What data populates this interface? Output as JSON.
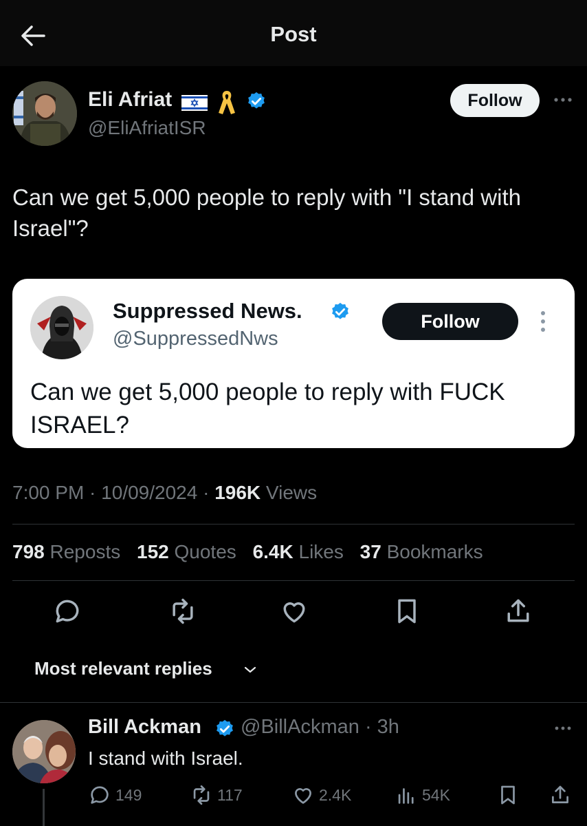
{
  "header": {
    "title": "Post"
  },
  "post": {
    "author": {
      "name": "Eli Afriat",
      "handle": "@EliAfriatISR"
    },
    "follow_label": "Follow",
    "text": "Can we get 5,000 people to reply with \"I stand with Israel\"?",
    "quote": {
      "name": "Suppressed News.",
      "handle": "@SuppressedNws",
      "follow_label": "Follow",
      "text": "Can we get 5,000 people to reply with FUCK ISRAEL?"
    },
    "time": "7:00 PM",
    "date": "10/09/2024",
    "views_count": "196K",
    "views_label": "Views",
    "stats": [
      {
        "count": "798",
        "label": "Reposts"
      },
      {
        "count": "152",
        "label": "Quotes"
      },
      {
        "count": "6.4K",
        "label": "Likes"
      },
      {
        "count": "37",
        "label": "Bookmarks"
      }
    ]
  },
  "replies": {
    "sort_label": "Most relevant replies",
    "items": [
      {
        "name": "Bill Ackman",
        "handle": "@BillAckman",
        "time": "3h",
        "text": "I stand with Israel.",
        "replies": "149",
        "reposts": "117",
        "likes": "2.4K",
        "views": "54K"
      }
    ]
  },
  "colors": {
    "background": "#000000",
    "verified": "#1d9bf0",
    "muted": "#71767b",
    "text": "#e7e9ea"
  },
  "icons": [
    "back-arrow-icon",
    "israel-flag-icon",
    "yellow-ribbon-icon",
    "verified-badge-icon",
    "more-icon",
    "reply-icon",
    "repost-icon",
    "like-icon",
    "bookmark-icon",
    "share-icon",
    "views-icon",
    "chevron-down-icon"
  ]
}
